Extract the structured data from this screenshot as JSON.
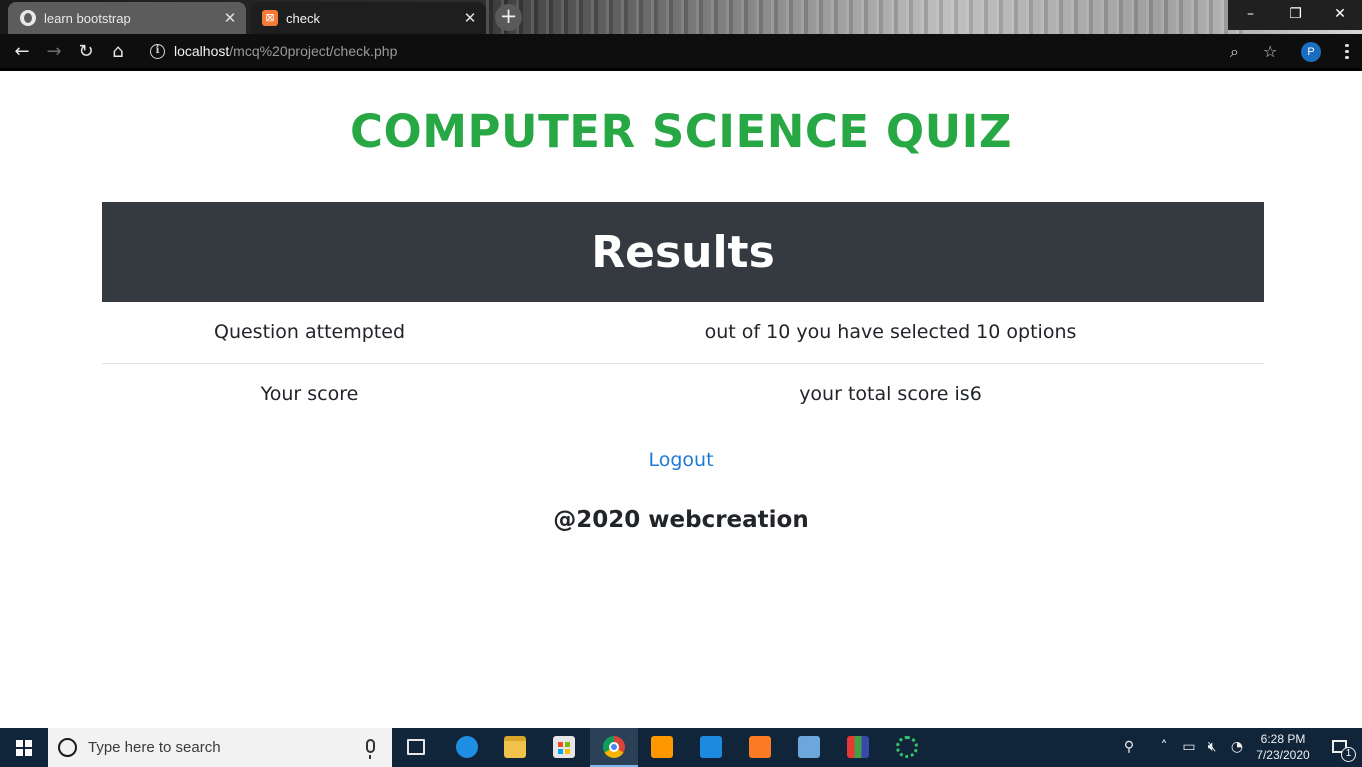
{
  "browser": {
    "tabs": [
      {
        "title": "learn bootstrap",
        "active": false
      },
      {
        "title": "check",
        "active": true
      }
    ],
    "new_tab_symbol": "+",
    "window_controls": {
      "minimize": "–",
      "maximize": "❐",
      "close": "✕"
    },
    "address": {
      "host": "localhost",
      "path": "/mcq%20project/check.php"
    },
    "profile_initial": "P",
    "icons": [
      "back-arrow-icon",
      "forward-arrow-icon",
      "reload-icon",
      "home-icon",
      "info-icon",
      "zoom-icon",
      "star-icon",
      "menu-icon"
    ]
  },
  "page": {
    "title": "COMPUTER SCIENCE QUIZ",
    "title_color": "#28a745",
    "results_heading": "Results",
    "rows": [
      {
        "label": "Question attempted",
        "value": "out of 10 you have selected 10 options"
      },
      {
        "label": "Your score",
        "value": "your total score is6"
      }
    ],
    "logout_label": "Logout",
    "footer": "@2020 webcreation"
  },
  "taskbar": {
    "search_placeholder": "Type here to search",
    "apps": [
      "task-view",
      "edge",
      "file-explorer",
      "store",
      "chrome",
      "sublime-text",
      "mail",
      "xampp",
      "virtualbox",
      "winrar",
      "loader"
    ],
    "active_app": "chrome",
    "clock": {
      "time": "6:28 PM",
      "date": "7/23/2020"
    },
    "notification_count": "1"
  }
}
